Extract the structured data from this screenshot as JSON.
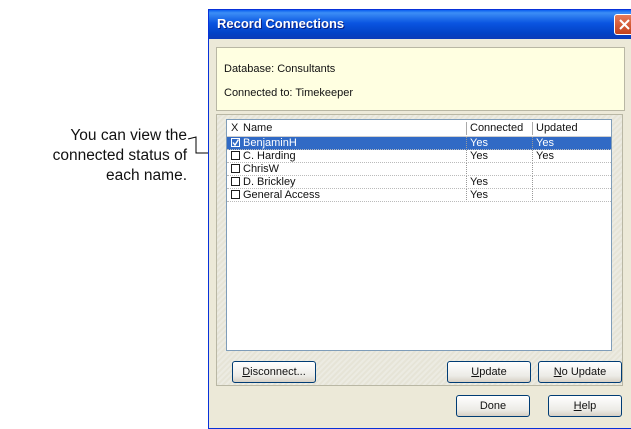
{
  "annotation": {
    "lines": [
      "You can view the",
      "connected status of",
      "each name."
    ]
  },
  "dialog": {
    "title": "Record Connections",
    "info": {
      "database": "Database: Consultants",
      "connected_to": "Connected to: Timekeeper"
    },
    "list": {
      "header": {
        "check_icon": "X",
        "name": "Name",
        "connected": "Connected",
        "updated": "Updated"
      },
      "rows": [
        {
          "checked": true,
          "name": "BenjaminH",
          "connected": "Yes",
          "updated": "Yes",
          "selected": true
        },
        {
          "checked": false,
          "name": "C. Harding",
          "connected": "Yes",
          "updated": "Yes",
          "selected": false
        },
        {
          "checked": false,
          "name": "ChrisW",
          "connected": "",
          "updated": "",
          "selected": false
        },
        {
          "checked": false,
          "name": "D. Brickley",
          "connected": "Yes",
          "updated": "",
          "selected": false
        },
        {
          "checked": false,
          "name": "General Access",
          "connected": "Yes",
          "updated": "",
          "selected": false
        }
      ]
    },
    "buttons": {
      "disconnect": {
        "mnemonic": "D",
        "rest": "isconnect..."
      },
      "update": {
        "mnemonic": "U",
        "rest": "pdate"
      },
      "no_update": {
        "mnemonic": "N",
        "rest": "o Update"
      },
      "done": "Done",
      "help": {
        "mnemonic": "H",
        "rest": "elp"
      }
    }
  },
  "colors": {
    "titlebar": "#0a55e1",
    "selection": "#316ac5",
    "info_panel": "#ffffe1",
    "dialog_face": "#ece9d8"
  }
}
